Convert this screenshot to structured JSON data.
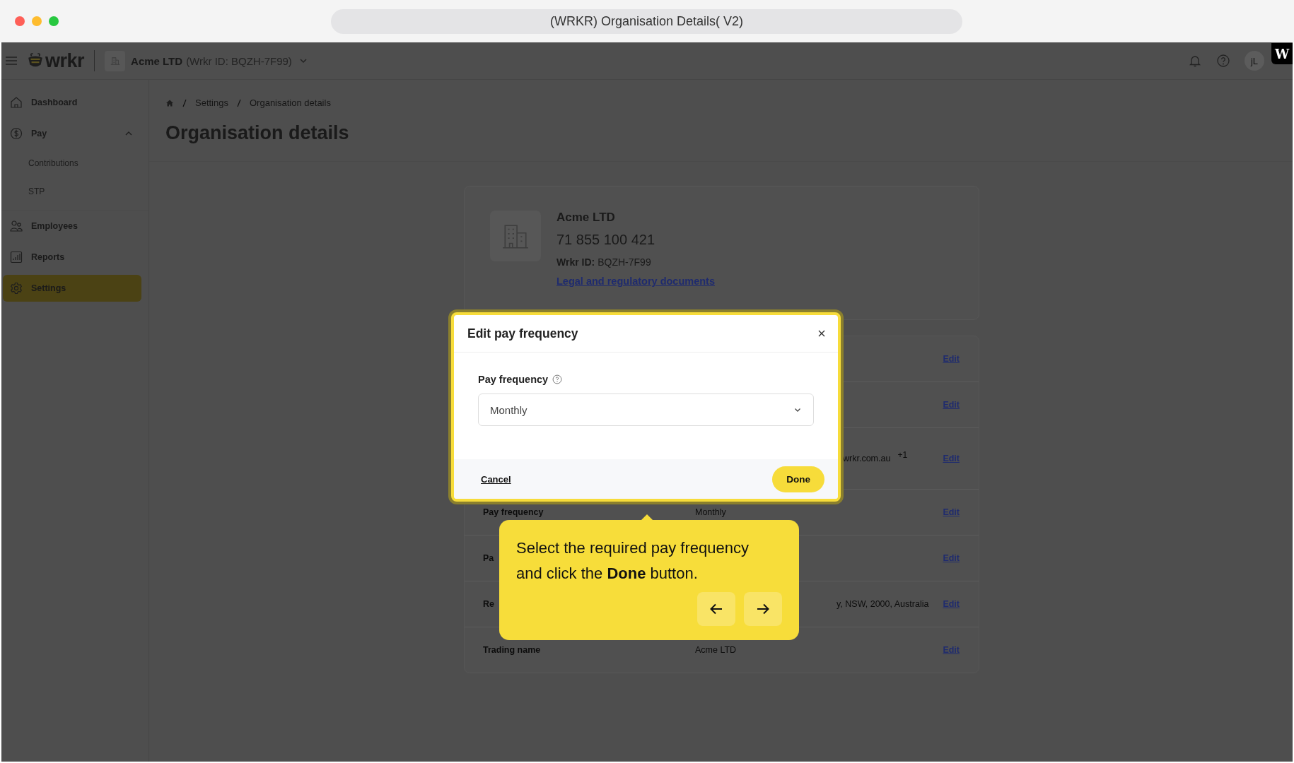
{
  "browser": {
    "title": "(WRKR) Organisation Details( V2)"
  },
  "topbar": {
    "logo": "wrkr",
    "org_name": "Acme LTD",
    "org_id": "(Wrkr ID: BQZH-7F99)",
    "avatar": "jL",
    "badge": "W"
  },
  "sidebar": {
    "items": [
      {
        "label": "Dashboard",
        "selected": false
      },
      {
        "label": "Pay",
        "selected": false,
        "expanded": true,
        "children": [
          {
            "label": "Contributions",
            "selected": false
          },
          {
            "label": "STP",
            "selected": false
          }
        ]
      },
      {
        "label": "Employees",
        "selected": false
      },
      {
        "label": "Reports",
        "selected": false
      },
      {
        "label": "Settings",
        "selected": true
      }
    ]
  },
  "breadcrumb": [
    "Settings",
    "Organisation details"
  ],
  "page_title": "Organisation details",
  "org_card": {
    "name": "Acme LTD",
    "abn": "71 855 100 421",
    "id_label": "Wrkr ID:",
    "id_value": "BQZH-7F99",
    "link": "Legal and regulatory documents"
  },
  "details_rows": [
    {
      "action": "Edit"
    },
    {
      "action": "Edit"
    },
    {
      "value_tail": "wrkr.com.au",
      "extra": "+1",
      "action": "Edit"
    },
    {
      "label": "Pay frequency",
      "value": "Monthly",
      "action": "Edit"
    },
    {
      "label": "Pa",
      "action": "Edit"
    },
    {
      "label": "Re",
      "value_tail": "y, NSW, 2000, Australia",
      "action": "Edit"
    },
    {
      "label": "Trading name",
      "value": "Acme LTD",
      "action": "Edit"
    }
  ],
  "modal": {
    "title": "Edit pay frequency",
    "field_label": "Pay frequency",
    "field_value": "Monthly",
    "cancel": "Cancel",
    "done": "Done"
  },
  "tooltip": {
    "text": "Select the required pay frequency and click the **Done** button."
  }
}
